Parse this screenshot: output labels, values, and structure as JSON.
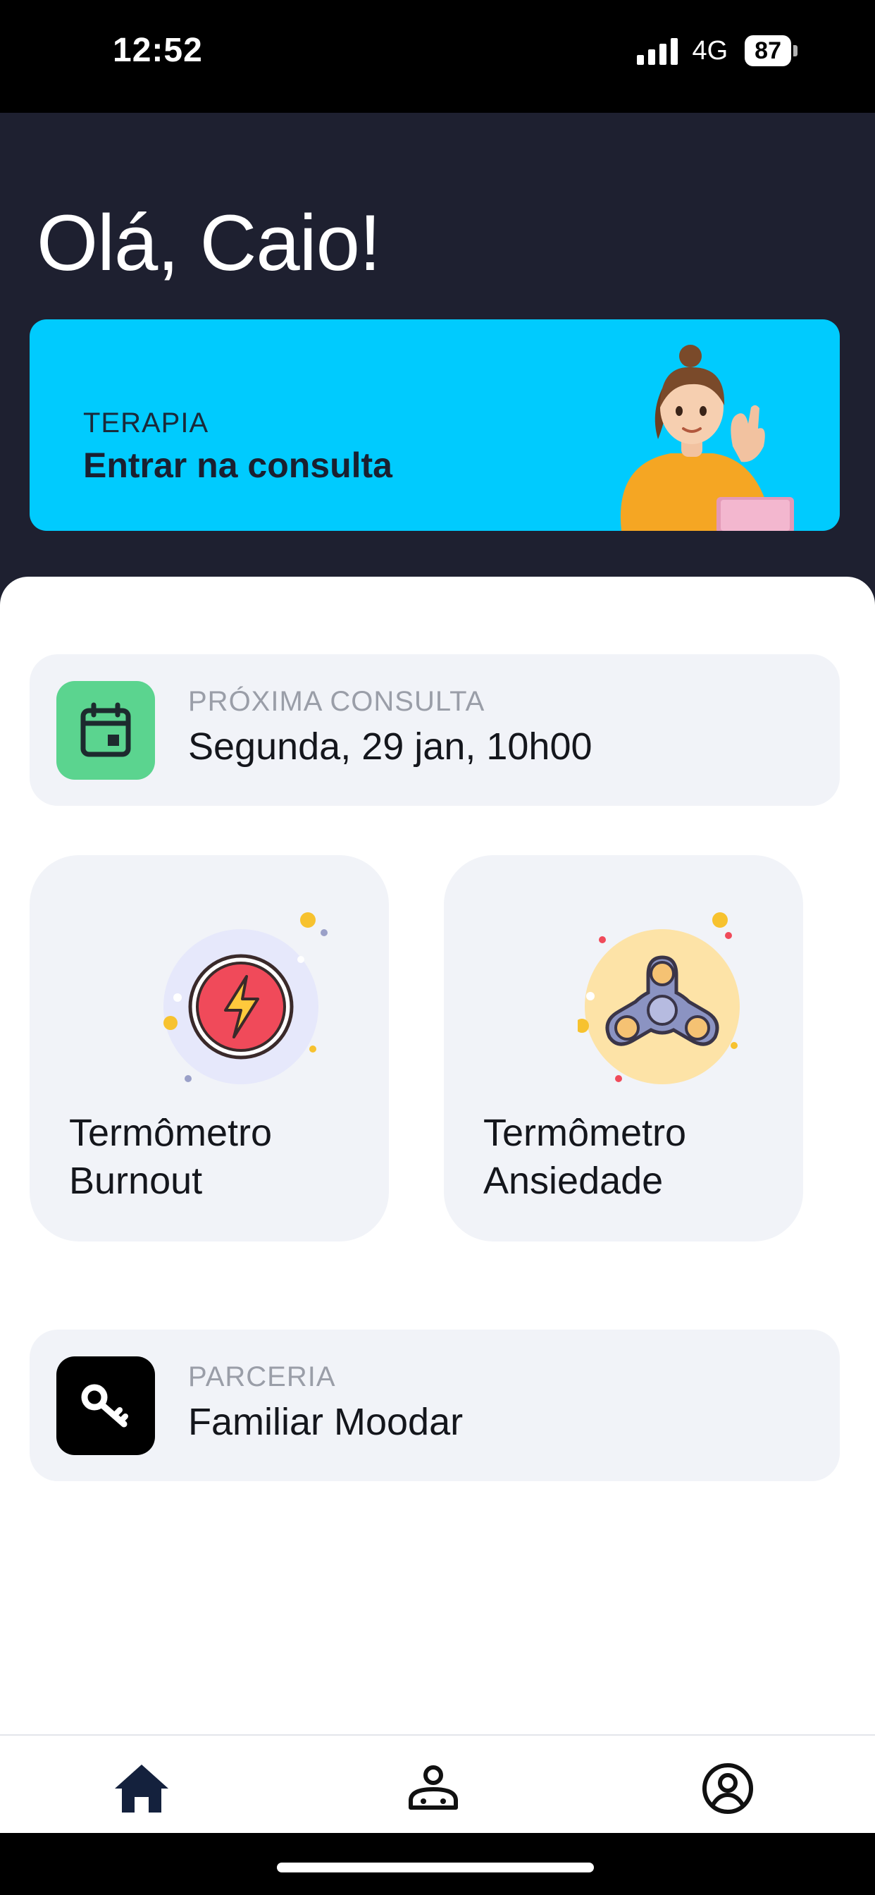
{
  "status_bar": {
    "time": "12:52",
    "network": "4G",
    "battery": "87"
  },
  "header": {
    "greeting": "Olá, Caio!"
  },
  "therapy_card": {
    "kicker": "TERAPIA",
    "title": "Entrar na consulta",
    "color": "#00cbfe"
  },
  "next_appointment": {
    "kicker": "PRÓXIMA CONSULTA",
    "value": "Segunda, 29 jan, 10h00",
    "icon": "calendar-icon",
    "icon_bg": "#5bd48f"
  },
  "tiles": [
    {
      "label_line1": "Termômetro",
      "label_line2": "Burnout",
      "icon": "lightning-icon"
    },
    {
      "label_line1": "Termômetro",
      "label_line2": "Ansiedade",
      "icon": "fidget-spinner-icon"
    }
  ],
  "partnership": {
    "kicker": "PARCERIA",
    "value": "Familiar Moodar",
    "icon": "key-icon",
    "icon_bg": "#000000"
  },
  "bottom_nav": [
    {
      "name": "home",
      "icon": "home-icon",
      "active": true
    },
    {
      "name": "therapist",
      "icon": "therapist-icon",
      "active": false
    },
    {
      "name": "profile",
      "icon": "profile-icon",
      "active": false
    }
  ]
}
